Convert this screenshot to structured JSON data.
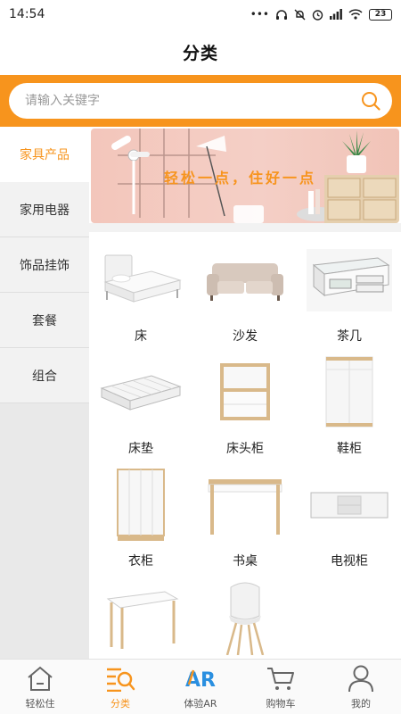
{
  "status_bar": {
    "time": "14:54",
    "battery": "23"
  },
  "header": {
    "title": "分类"
  },
  "search": {
    "placeholder": "请输入关键字"
  },
  "sidebar": {
    "items": [
      {
        "label": "家具产品",
        "active": true
      },
      {
        "label": "家用电器",
        "active": false
      },
      {
        "label": "饰品挂饰",
        "active": false
      },
      {
        "label": "套餐",
        "active": false
      },
      {
        "label": "组合",
        "active": false
      }
    ]
  },
  "banner": {
    "text": "轻松一点，住好一点"
  },
  "products": [
    {
      "label": "床",
      "icon": "bed-icon"
    },
    {
      "label": "沙发",
      "icon": "sofa-icon"
    },
    {
      "label": "茶几",
      "icon": "coffee-table-icon"
    },
    {
      "label": "床垫",
      "icon": "mattress-icon"
    },
    {
      "label": "床头柜",
      "icon": "nightstand-icon"
    },
    {
      "label": "鞋柜",
      "icon": "shoe-cabinet-icon"
    },
    {
      "label": "衣柜",
      "icon": "wardrobe-icon"
    },
    {
      "label": "书桌",
      "icon": "desk-icon"
    },
    {
      "label": "电视柜",
      "icon": "tv-cabinet-icon"
    },
    {
      "label": "",
      "icon": "table-icon"
    },
    {
      "label": "",
      "icon": "chair-icon"
    }
  ],
  "bottom_nav": {
    "items": [
      {
        "label": "轻松住",
        "icon": "home-icon"
      },
      {
        "label": "分类",
        "icon": "category-icon",
        "active": true
      },
      {
        "label": "体验AR",
        "icon": "ar-icon"
      },
      {
        "label": "购物车",
        "icon": "cart-icon"
      },
      {
        "label": "我的",
        "icon": "user-icon"
      }
    ]
  },
  "colors": {
    "accent": "#f7941d",
    "ar_blue": "#2a8fe0"
  }
}
